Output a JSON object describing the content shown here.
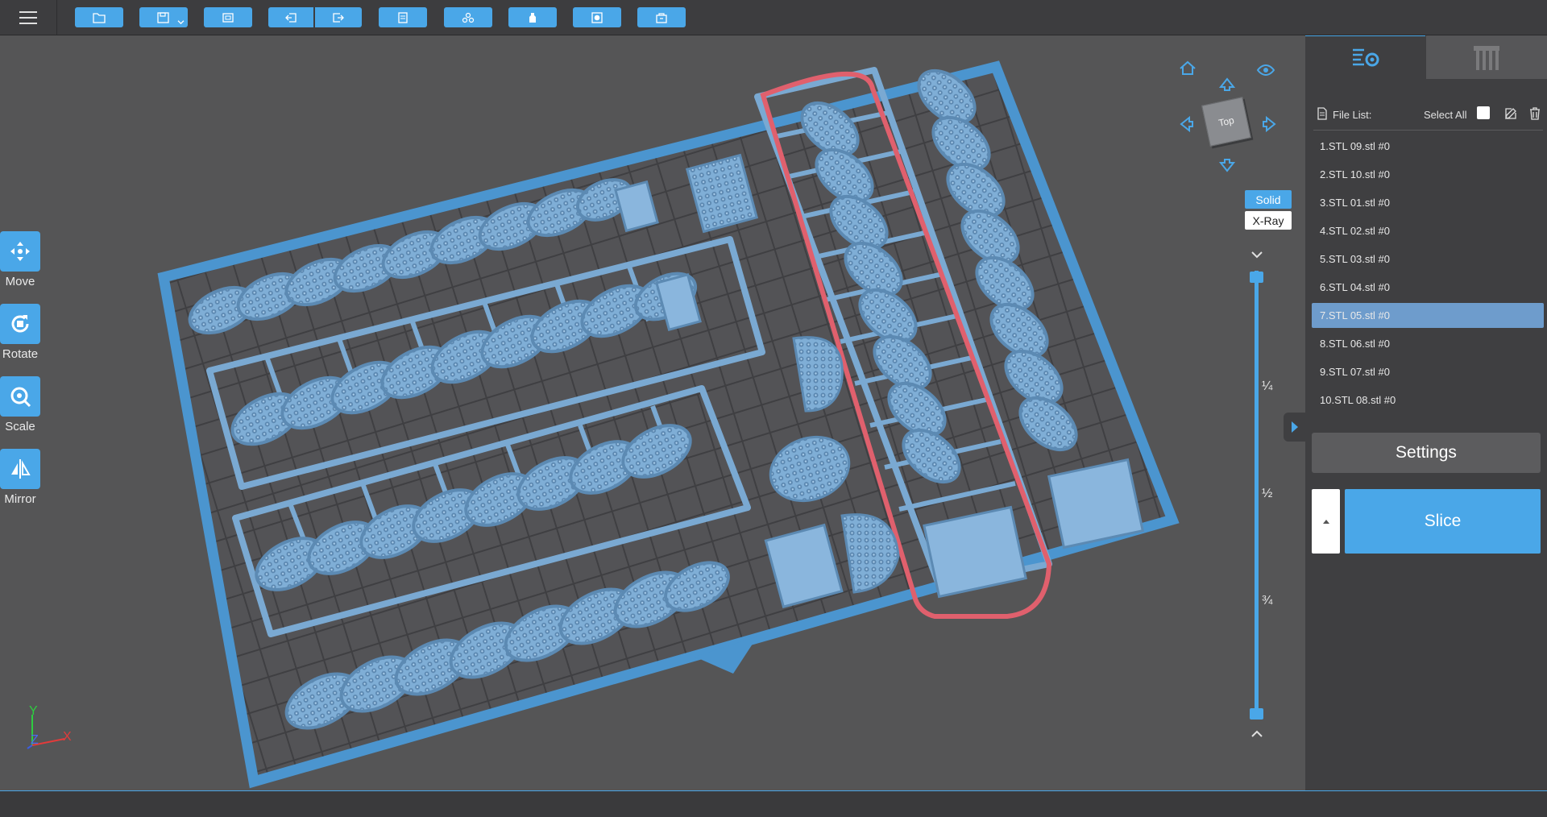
{
  "toolbar": {
    "buttons": [
      {
        "name": "open-file-button",
        "icon": "folder-icon"
      },
      {
        "name": "save-button",
        "icon": "save-icon"
      },
      {
        "name": "screenshot-button",
        "icon": "frame-icon"
      },
      {
        "name": "import-button",
        "icon": "import-icon"
      },
      {
        "name": "export-button",
        "icon": "export-icon"
      },
      {
        "name": "copy-button",
        "icon": "copy-icon"
      },
      {
        "name": "auto-arrange-button",
        "icon": "arrange-icon"
      },
      {
        "name": "hollow-button",
        "icon": "bottle-icon"
      },
      {
        "name": "hole-button",
        "icon": "hole-icon"
      },
      {
        "name": "support-button",
        "icon": "box-icon"
      }
    ],
    "accent_color": "#4aa7e8"
  },
  "left_tools": [
    {
      "id": "move",
      "label": "Move",
      "icon": "move-icon"
    },
    {
      "id": "rotate",
      "label": "Rotate",
      "icon": "rotate-icon"
    },
    {
      "id": "scale",
      "label": "Scale",
      "icon": "scale-icon"
    },
    {
      "id": "mirror",
      "label": "Mirror",
      "icon": "mirror-icon"
    }
  ],
  "viewcube": {
    "face_label": "Top"
  },
  "render_mode": {
    "solid_label": "Solid",
    "xray_label": "X-Ray",
    "selected": "Solid"
  },
  "layer_slider": {
    "ticks": [
      "¼",
      "½",
      "¾"
    ]
  },
  "axes": {
    "y": "Y",
    "z": "Z",
    "x": "X"
  },
  "panel": {
    "tabs": [
      {
        "name": "tab-print-settings",
        "icon": "settings-list-icon",
        "active": true
      },
      {
        "name": "tab-supports",
        "icon": "support-pillars-icon",
        "active": false
      }
    ],
    "file_list_label": "File List:",
    "select_all_label": "Select All",
    "files": [
      {
        "label": "1.STL 09.stl #0",
        "selected": false
      },
      {
        "label": "2.STL 10.stl #0",
        "selected": false
      },
      {
        "label": "3.STL 01.stl #0",
        "selected": false
      },
      {
        "label": "4.STL 02.stl #0",
        "selected": false
      },
      {
        "label": "5.STL 03.stl #0",
        "selected": false
      },
      {
        "label": "6.STL 04.stl #0",
        "selected": false
      },
      {
        "label": "7.STL 05.stl #0",
        "selected": true
      },
      {
        "label": "8.STL 06.stl #0",
        "selected": false
      },
      {
        "label": "9.STL 07.stl #0",
        "selected": false
      },
      {
        "label": "10.STL 08.stl #0",
        "selected": false
      }
    ],
    "settings_label": "Settings",
    "slice_label": "Slice"
  },
  "colors": {
    "model": "#6f9fc7",
    "plate_border": "#4b95cf",
    "selected_sprue": "#e0606d",
    "background": "#555556"
  }
}
